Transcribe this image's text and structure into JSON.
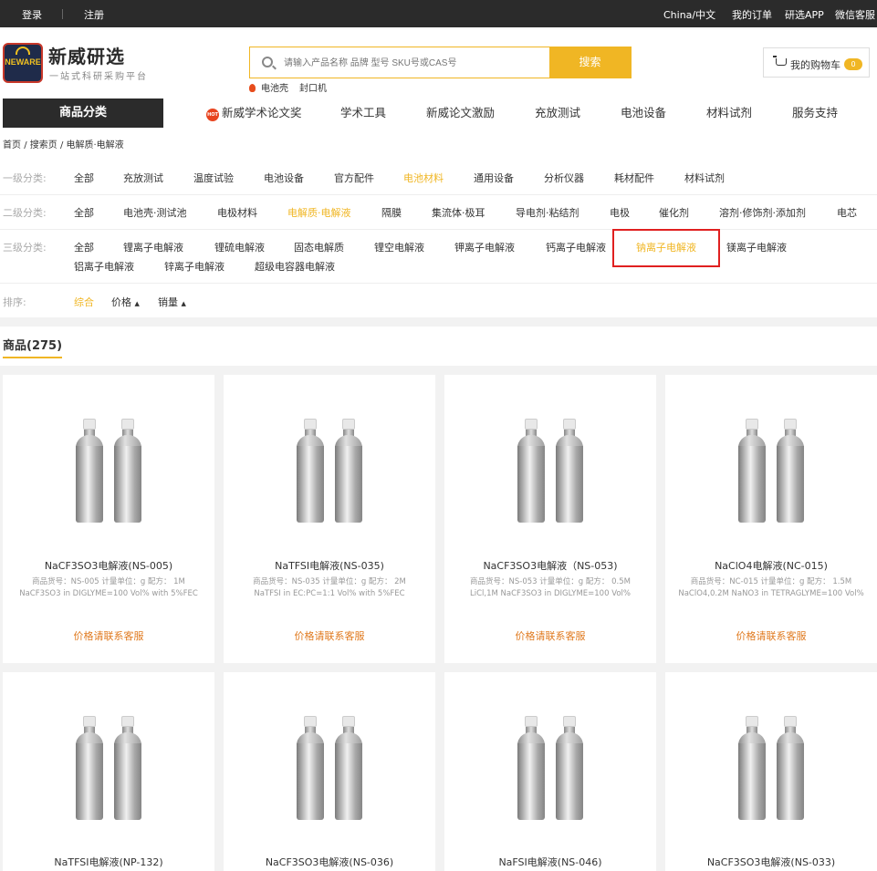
{
  "topbar": {
    "login": "登录",
    "register": "注册",
    "region": "China/中文",
    "my_orders": "我的订单",
    "app": "研选APP",
    "wechat": "微信客服"
  },
  "header": {
    "logo_text": "NEWARE",
    "brand": "新威研选",
    "tagline": "一站式科研采购平台",
    "search_placeholder": "请输入产品名称 品牌 型号 SKU号或CAS号",
    "search_button": "搜索",
    "hot_searches": [
      "电池壳",
      "封口机"
    ],
    "cart_label": "我的购物车",
    "cart_count": "0"
  },
  "nav": {
    "category_button": "商品分类",
    "hot_badge": "HOT",
    "items": [
      "新威学术论文奖",
      "学术工具",
      "新威论文激励",
      "充放测试",
      "电池设备",
      "材料试剂",
      "服务支持"
    ]
  },
  "breadcrumb": {
    "home": "首页",
    "search": "搜索页",
    "current": "电解质·电解液",
    "separator": "/"
  },
  "filters": {
    "level1": {
      "label": "一级分类:",
      "options": [
        "全部",
        "充放测试",
        "温度试验",
        "电池设备",
        "官方配件",
        "电池材料",
        "通用设备",
        "分析仪器",
        "耗材配件",
        "材料试剂"
      ],
      "active": "电池材料"
    },
    "level2": {
      "label": "二级分类:",
      "options": [
        "全部",
        "电池壳·测试池",
        "电极材料",
        "电解质·电解液",
        "隔膜",
        "集流体·极耳",
        "导电剂·粘结剂",
        "电极",
        "催化剂",
        "溶剂·修饰剂·添加剂",
        "电芯"
      ],
      "active": "电解质·电解液"
    },
    "level3": {
      "label": "三级分类:",
      "options": [
        "全部",
        "锂离子电解液",
        "锂硫电解液",
        "固态电解质",
        "锂空电解液",
        "钾离子电解液",
        "钙离子电解液",
        "钠离子电解液",
        "镁离子电解液",
        "铝离子电解液",
        "锌离子电解液",
        "超级电容器电解液"
      ],
      "active": "钠离子电解液"
    },
    "sort": {
      "label": "排序:",
      "options": [
        "综合",
        "价格",
        "销量"
      ],
      "active": "综合"
    }
  },
  "product_count": "商品(275)",
  "products": [
    {
      "name": "NaCF3SO3电解液(NS-005)",
      "meta1": "商品货号：NS-005 计量单位：g 配方： 1M",
      "meta2": "NaCF3SO3 in DIGLYME=100 Vol% with 5%FEC",
      "price": "价格请联系客服"
    },
    {
      "name": "NaTFSI电解液(NS-035)",
      "meta1": "商品货号：NS-035 计量单位：g 配方： 2M",
      "meta2": "NaTFSI in EC:PC=1:1 Vol% with 5%FEC",
      "price": "价格请联系客服"
    },
    {
      "name": "NaCF3SO3电解液（NS-053)",
      "meta1": "商品货号：NS-053 计量单位：g 配方： 0.5M",
      "meta2": "LiCl,1M NaCF3SO3 in DIGLYME=100 Vol%",
      "price": "价格请联系客服"
    },
    {
      "name": "NaClO4电解液(NC-015)",
      "meta1": "商品货号：NC-015 计量单位：g 配方： 1.5M",
      "meta2": "NaClO4,0.2M NaNO3 in TETRAGLYME=100 Vol%",
      "price": "价格请联系客服"
    },
    {
      "name": "NaTFSI电解液(NP-132)",
      "meta1": "",
      "meta2": "",
      "price": ""
    },
    {
      "name": "NaCF3SO3电解液(NS-036)",
      "meta1": "",
      "meta2": "",
      "price": ""
    },
    {
      "name": "NaFSI电解液(NS-046)",
      "meta1": "",
      "meta2": "",
      "price": ""
    },
    {
      "name": "NaCF3SO3电解液(NS-033)",
      "meta1": "",
      "meta2": "",
      "price": ""
    }
  ],
  "colors": {
    "accent": "#f0b624",
    "dark": "#2b2b2b",
    "price": "#e07a1f",
    "highlight_border": "#e02020"
  }
}
